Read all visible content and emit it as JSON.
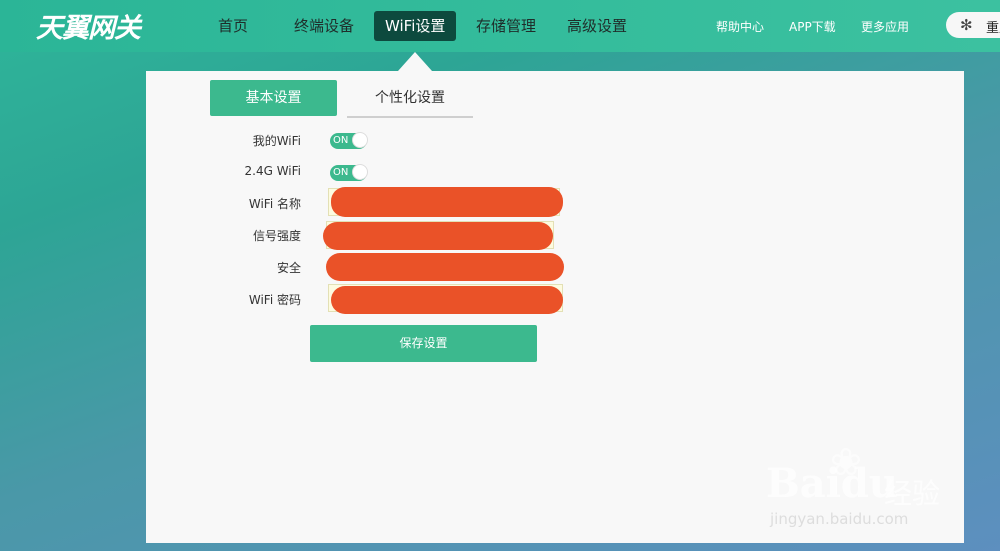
{
  "header": {
    "logo": "天翼网关",
    "nav": [
      "首页",
      "终端设备",
      "WiFi设置",
      "存储管理",
      "高级设置"
    ],
    "active_nav": "WiFi设置",
    "links": [
      "帮助中心",
      "APP下载",
      "更多应用"
    ],
    "restart_label": "重启",
    "spinner_icon": "spinner-icon"
  },
  "tabs": {
    "basic": "基本设置",
    "personal": "个性化设置"
  },
  "form": {
    "my_wifi_label": "我的WiFi",
    "wifi24_label": "2.4G WiFi",
    "toggle_on_text": "ON",
    "wifi_name_label": "WiFi 名称",
    "signal_label": "信号强度",
    "security_label": "安全",
    "password_label": "WiFi 密码",
    "save_label": "保存设置"
  },
  "watermark": {
    "brand": "Bai",
    "brand2": "du",
    "cn": "经验",
    "url": "jingyan.baidu.com"
  },
  "colors": {
    "accent": "#3cb98e",
    "topbar": "#35bd9c",
    "active_nav": "#0d4a3e",
    "redaction": "#ea5228"
  }
}
